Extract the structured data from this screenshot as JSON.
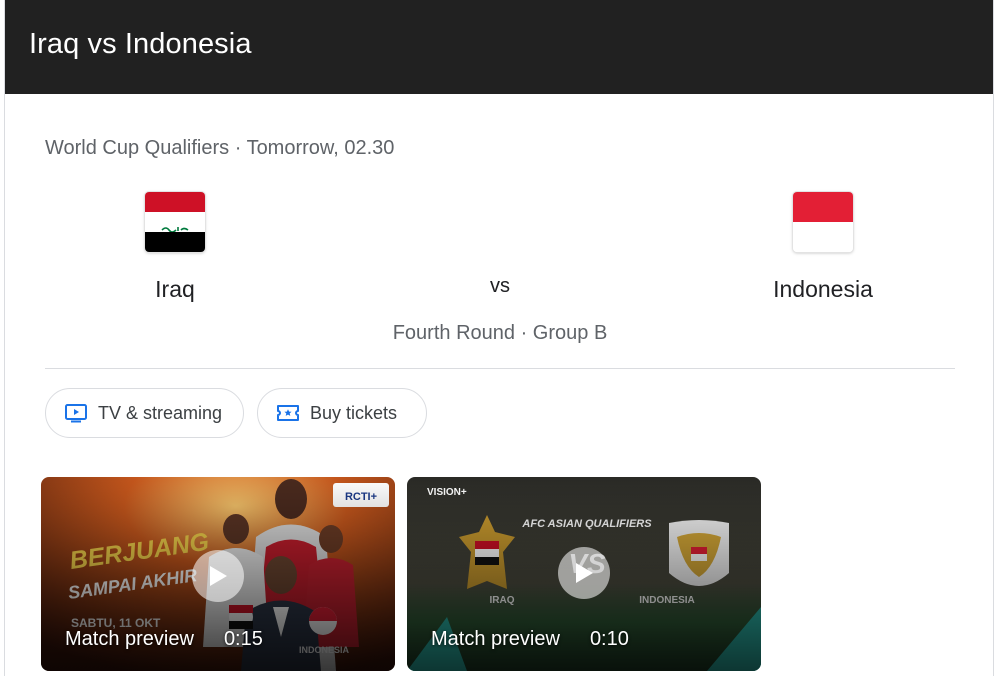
{
  "header": {
    "title": "Iraq vs Indonesia"
  },
  "match": {
    "competition": "World Cup Qualifiers",
    "separator": " · ",
    "time": "Tomorrow, 02.30",
    "home": {
      "name": "Iraq",
      "flag": "iraq-flag"
    },
    "vs_label": "vs",
    "away": {
      "name": "Indonesia",
      "flag": "indonesia-flag"
    },
    "round": "Fourth Round",
    "group": "Group B"
  },
  "chips": {
    "tv_label": "TV & streaming",
    "tv_icon": "tv-icon",
    "tickets_label": "Buy tickets",
    "tickets_icon": "ticket-icon"
  },
  "videos": [
    {
      "title": "Match preview",
      "duration": "0:15",
      "poster_text": [
        "BERJUANG",
        "SAMPAI AKHIR",
        "SABTU, 11 OKT",
        "INDONESIA",
        "RCTI+"
      ]
    },
    {
      "title": "Match preview",
      "duration": "0:10",
      "poster_text": [
        "VISION+",
        "AFC ASIAN QUALIFIERS",
        "VS",
        "IRAQ",
        "INDONESIA"
      ]
    }
  ],
  "colors": {
    "header_bg": "#212121",
    "iraq_red": "#ce1126",
    "iraq_green": "#007a3d",
    "indonesia_red": "#e31f35",
    "chip_icon": "#1a73e8"
  }
}
